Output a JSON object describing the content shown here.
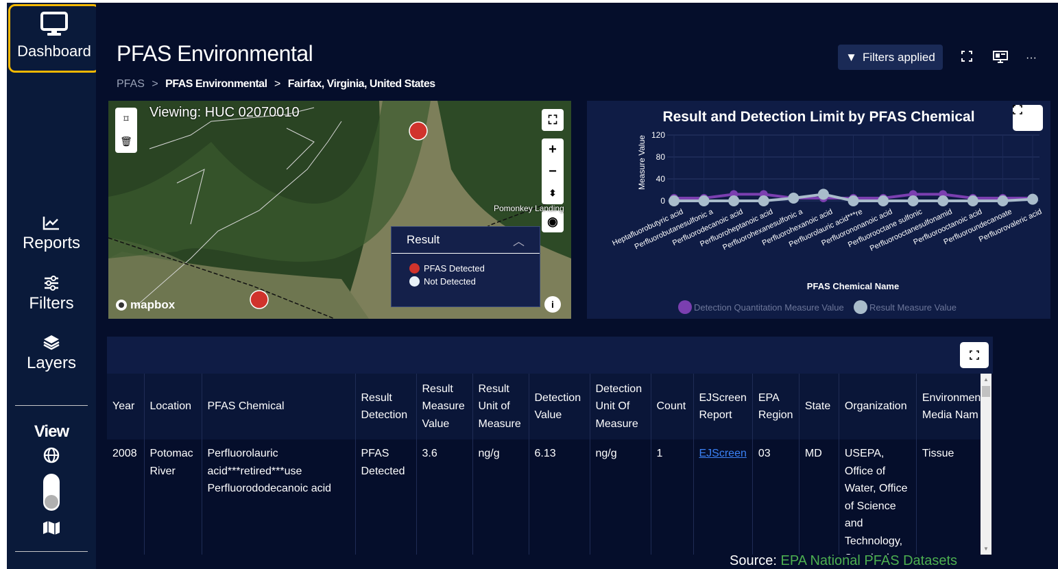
{
  "sidebar": {
    "dashboard_label": "Dashboard",
    "reports_label": "Reports",
    "filters_label": "Filters",
    "layers_label": "Layers",
    "view_label": "View"
  },
  "header": {
    "title": "PFAS Environmental",
    "breadcrumb": [
      "PFAS",
      "PFAS Environmental",
      "Fairfax, Virginia, United States"
    ],
    "breadcrumb_sep": ">",
    "filters_label": "Filters applied"
  },
  "map": {
    "viewing": "Viewing: HUC 02070010",
    "place_label": "Pomonkey Landing",
    "logo": "mapbox",
    "legend": {
      "title": "Result",
      "items": [
        {
          "label": "PFAS Detected",
          "color": "#d0332c"
        },
        {
          "label": "Not Detected",
          "color": "#e8f1f8"
        }
      ]
    }
  },
  "chart_data": {
    "type": "line",
    "title": "Result and Detection Limit by PFAS Chemical",
    "xlabel": "PFAS Chemical Name",
    "ylabel": "Measure Value",
    "ylim": [
      0,
      120
    ],
    "yticks": [
      0,
      40,
      80,
      120
    ],
    "categories": [
      "Heptafluorobutyric acid",
      "Perfluorobutanesulfonic a",
      "Perfluorodecanoic acid",
      "Perfluoroheptanoic acid",
      "Perfluorohexanesulfonic a",
      "Perfluorohexanoic acid",
      "Perfluorolauric acid***re",
      "Perfluorononanoic acid",
      "Perfluorooctane sulfonic",
      "Perfluorooctanesulfonamid",
      "Perfluorooctanoic acid",
      "Perfluoroundecanoate",
      "Perfluorovaleric acid"
    ],
    "series": [
      {
        "name": "Detection Quantitation Measure Value",
        "color": "#7b3fb0",
        "values": [
          5,
          5,
          12,
          12,
          5,
          5,
          5,
          5,
          12,
          12,
          5,
          5,
          5
        ]
      },
      {
        "name": "Result Measure Value",
        "color": "#a9bccb",
        "values": [
          0,
          0,
          0,
          0,
          5,
          12,
          0,
          0,
          0,
          0,
          0,
          0,
          3
        ]
      }
    ],
    "legend": "bottom"
  },
  "table": {
    "columns": [
      "Year",
      "Location",
      "PFAS Chemical",
      "Result Detection",
      "Result Measure Value",
      "Result Unit of Measure",
      "Detection Value",
      "Detection Unit Of Measure",
      "Count",
      "EJScreen Report",
      "EPA Region",
      "State",
      "Organization",
      "Environmen Media Nam"
    ],
    "rows": [
      {
        "year": "2008",
        "location": "Potomac River",
        "chemical": "Perfluorolauric acid***retired***use Perfluorododecanoic acid",
        "detection": "PFAS Detected",
        "measure_value": "3.6",
        "unit": "ng/g",
        "detection_value": "6.13",
        "detection_unit": "ng/g",
        "count": "1",
        "ejscreen": "EJScreen",
        "epa_region": "03",
        "state": "MD",
        "organization": "USEPA, Office of Water, Office of Science and Technology, Standards",
        "media": "Tissue"
      }
    ]
  },
  "source": {
    "prefix": "Source: ",
    "link": "EPA National PFAS Datasets"
  }
}
